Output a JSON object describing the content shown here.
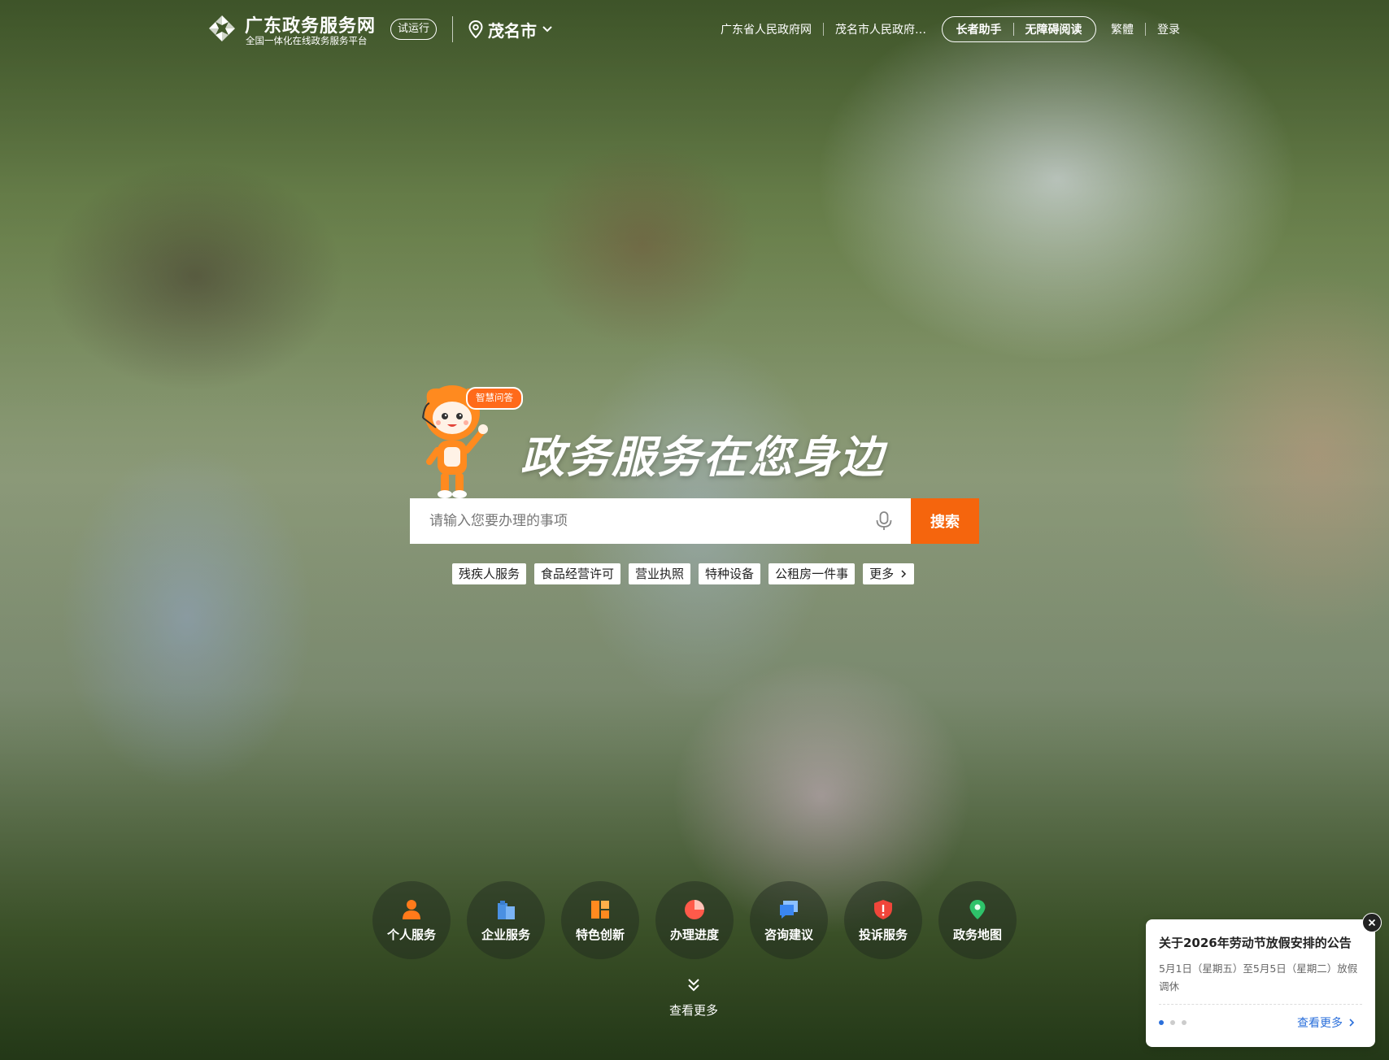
{
  "header": {
    "title": "广东政务服务网",
    "subtitle": "全国一体化在线政务服务平台",
    "badge": "试运行",
    "city": "茂名市",
    "links": [
      "广东省人民政府网",
      "茂名市人民政府…"
    ],
    "accessibility": [
      "长者助手",
      "无障碍阅读"
    ],
    "traditional": "繁體",
    "login": "登录"
  },
  "hero": {
    "mascot_tag": "智慧问答",
    "slogan": "政务服务在您身边"
  },
  "search": {
    "placeholder": "请输入您要办理的事项",
    "button": "搜索"
  },
  "hot_tags": [
    "残疾人服务",
    "食品经营许可",
    "营业执照",
    "特种设备",
    "公租房一件事",
    "更多"
  ],
  "services": [
    {
      "label": "个人服务",
      "icon": "person-icon"
    },
    {
      "label": "企业服务",
      "icon": "building-icon"
    },
    {
      "label": "特色创新",
      "icon": "grid-icon"
    },
    {
      "label": "办理进度",
      "icon": "pie-chart-icon"
    },
    {
      "label": "咨询建议",
      "icon": "chat-bubble-icon"
    },
    {
      "label": "投诉服务",
      "icon": "shield-alert-icon"
    },
    {
      "label": "政务地图",
      "icon": "map-pin-icon"
    }
  ],
  "more": "查看更多",
  "notice": {
    "title": "关于2026年劳动节放假安排的公告",
    "body": "5月1日（星期五）至5月5日（星期二）放假调休",
    "more": "查看更多",
    "slides_total": 3,
    "slide_active": 1
  },
  "colors": {
    "accent": "#f5650d",
    "link_blue": "#2a6fdb",
    "mascot_orange": "#ff8a1f"
  }
}
